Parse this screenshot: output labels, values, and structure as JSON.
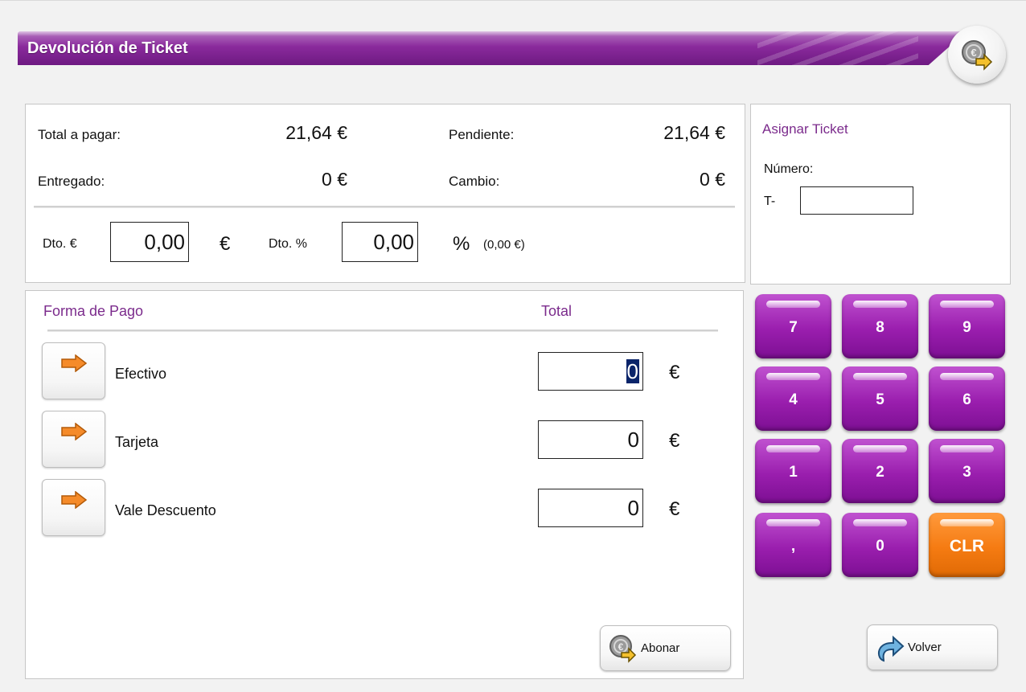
{
  "window": {
    "title": "Devolución de Ticket",
    "corner_icon": "coin-hand-icon"
  },
  "totals": {
    "total_label": "Total a pagar:",
    "total_value": "21,64 €",
    "pending_label": "Pendiente:",
    "pending_value": "21,64 €",
    "delivered_label": "Entregado:",
    "delivered_value": "0 €",
    "change_label": "Cambio:",
    "change_value": "0 €",
    "discount_eur_label": "Dto. €",
    "discount_eur_value": "0,00",
    "discount_eur_unit": "€",
    "discount_pct_label": "Dto. %",
    "discount_pct_value": "0,00",
    "discount_pct_unit": "%",
    "discount_pct_amount": "(0,00 €)"
  },
  "assign": {
    "title": "Asignar Ticket",
    "number_label": "Número:",
    "prefix": "T-",
    "number_value": ""
  },
  "payment": {
    "header_method": "Forma de Pago",
    "header_total": "Total",
    "currency": "€",
    "methods": [
      {
        "label": "Efectivo",
        "value": "0",
        "selected": true
      },
      {
        "label": "Tarjeta",
        "value": "0",
        "selected": false
      },
      {
        "label": "Vale Descuento",
        "value": "0",
        "selected": false
      }
    ]
  },
  "keypad": {
    "keys": [
      "7",
      "8",
      "9",
      "4",
      "5",
      "6",
      "1",
      "2",
      "3",
      ",",
      "0",
      "CLR"
    ]
  },
  "actions": {
    "abonar_label": "Abonar",
    "volver_label": "Volver"
  },
  "colors": {
    "accent_purple": "#8a2a9c",
    "heading_purple": "#7b2b8c",
    "clear_orange": "#f57b12",
    "arrow_orange": "#f58b2a"
  }
}
